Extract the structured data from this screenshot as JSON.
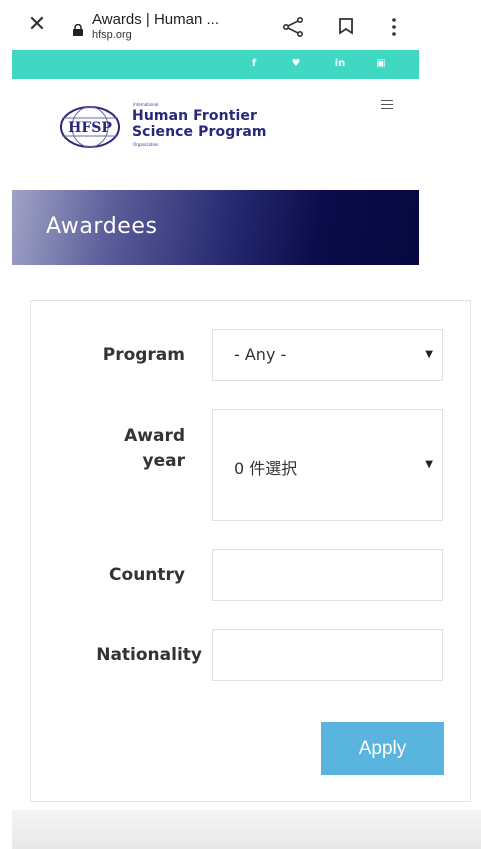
{
  "browser": {
    "tab_title": "Awards | Human ...",
    "url": "hfsp.org",
    "close_glyph": "✕"
  },
  "social_links": [
    {
      "label": "f",
      "icon": "facebook-icon"
    },
    {
      "label": "♥",
      "icon": "twitter-icon"
    },
    {
      "label": "in",
      "icon": "linkedin-icon"
    },
    {
      "label": "▣",
      "icon": "youtube-icon"
    }
  ],
  "logo": {
    "emblem_text": "HFSP",
    "small_top": "International",
    "line1": "Human Frontier",
    "line2": "Science Program",
    "small_bottom": "Organization"
  },
  "banner": {
    "title": "Awardees"
  },
  "filters": {
    "program_label": "Program",
    "program_value": "- Any -",
    "award_year_label_1": "Award",
    "award_year_label_2": "year",
    "award_year_value": "0 件選択",
    "country_label": "Country",
    "country_value": "",
    "nationality_label": "Nationality",
    "nationality_value": "",
    "caret": "▼",
    "apply_label": "Apply"
  },
  "colors": {
    "social_bar": "#40d7c3",
    "banner_dark": "#07083f",
    "apply_button": "#5ab5de",
    "logo_text": "#28287a"
  }
}
